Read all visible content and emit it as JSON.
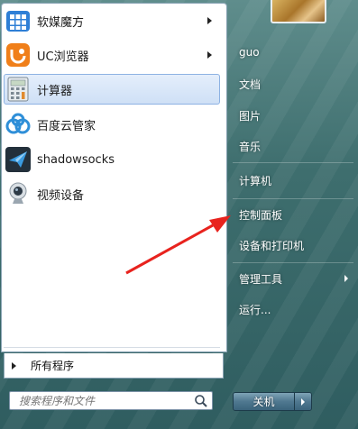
{
  "programs": [
    {
      "label": "软媒魔方",
      "icon": "rubik-cube-icon",
      "has_submenu": true,
      "selected": false
    },
    {
      "label": "UC浏览器",
      "icon": "uc-browser-icon",
      "has_submenu": true,
      "selected": false
    },
    {
      "label": "计算器",
      "icon": "calculator-icon",
      "has_submenu": false,
      "selected": true
    },
    {
      "label": "百度云管家",
      "icon": "baidu-cloud-icon",
      "has_submenu": false,
      "selected": false
    },
    {
      "label": "shadowsocks",
      "icon": "paper-plane-icon",
      "has_submenu": false,
      "selected": false
    },
    {
      "label": "视频设备",
      "icon": "webcam-icon",
      "has_submenu": false,
      "selected": false
    }
  ],
  "all_programs_label": "所有程序",
  "search": {
    "placeholder": "搜索程序和文件"
  },
  "right_menu": [
    {
      "label": "guo"
    },
    {
      "label": "文档"
    },
    {
      "label": "图片"
    },
    {
      "label": "音乐"
    },
    {
      "label": "计算机"
    },
    {
      "label": "控制面板"
    },
    {
      "label": "设备和打印机"
    },
    {
      "label": "管理工具"
    },
    {
      "label": "运行..."
    }
  ],
  "shutdown_label": "关机",
  "colors": {
    "annotation_arrow": "#e8231e",
    "selection": "#cfe0f6"
  }
}
